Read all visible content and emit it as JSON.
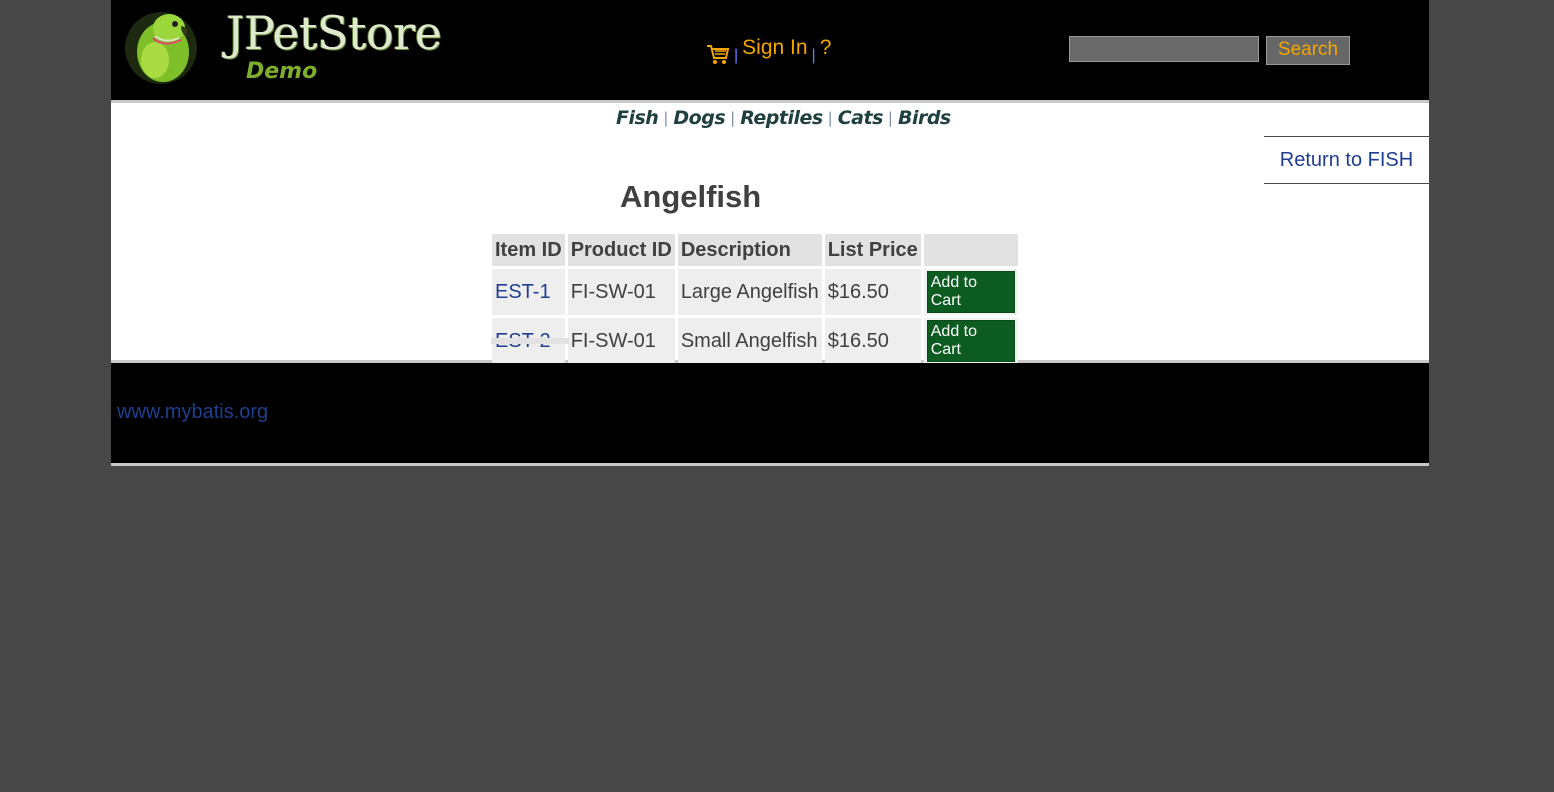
{
  "header": {
    "logo_title": "JPetStore",
    "logo_subtitle": "Demo",
    "menu": {
      "cart_icon": "shopping-cart-icon",
      "separator": "|",
      "sign_in": "Sign In",
      "help": "?"
    },
    "search": {
      "value": "",
      "button_label": "Search"
    }
  },
  "quicklinks": [
    "Fish",
    "Dogs",
    "Reptiles",
    "Cats",
    "Birds"
  ],
  "back_link": "Return to FISH",
  "main": {
    "title": "Angelfish",
    "columns": [
      "Item ID",
      "Product ID",
      "Description",
      "List Price",
      ""
    ],
    "rows": [
      {
        "item_id": "EST-1",
        "product_id": "FI-SW-01",
        "description": "Large Angelfish",
        "price": "$16.50",
        "action": "Add to Cart"
      },
      {
        "item_id": "EST-2",
        "product_id": "FI-SW-01",
        "description": "Small Angelfish",
        "price": "$16.50",
        "action": "Add to Cart"
      }
    ]
  },
  "footer": {
    "link": "www.mybatis.org"
  },
  "colors": {
    "page_bg": "#474747",
    "header_bg": "#000000",
    "accent_orange": "#f5a500",
    "link_blue": "#1f3e8f",
    "cart_button_green": "#0c5c22"
  }
}
